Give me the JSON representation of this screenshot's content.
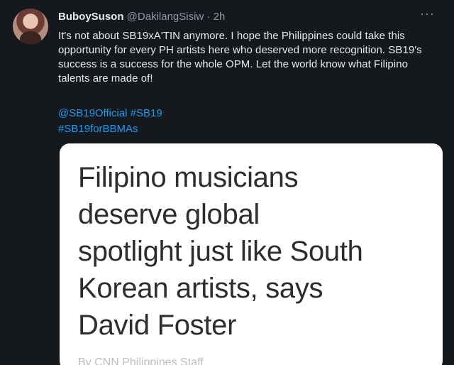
{
  "tweet": {
    "display_name": "BuboySuson",
    "handle": "@DakilangSisiw",
    "separator": "·",
    "time": "2h",
    "more_label": "···",
    "text": "It's not about SB19xA'TIN anymore. I hope the Philippines could take this opportunity for every PH artists here who deserved more recognition. SB19's success is a success for the whole OPM. Let the world know what Filipino talents are made of!",
    "mentions_line": [
      "@SB19Official",
      "#SB19"
    ],
    "hashtag_line": [
      "#SB19forBBMAs"
    ]
  },
  "card": {
    "headline_lines": [
      "Filipino musicians",
      "deserve global",
      "spotlight just like South",
      "Korean artists, says",
      "David Foster"
    ],
    "byline": "By CNN Philippines Staff"
  },
  "colors": {
    "background": "#15181c",
    "link": "#1d9bf0",
    "muted": "#8b98a5",
    "card": "#ffffff"
  },
  "icons": {
    "avatar": "profile-photo",
    "more": "more-options-icon"
  }
}
